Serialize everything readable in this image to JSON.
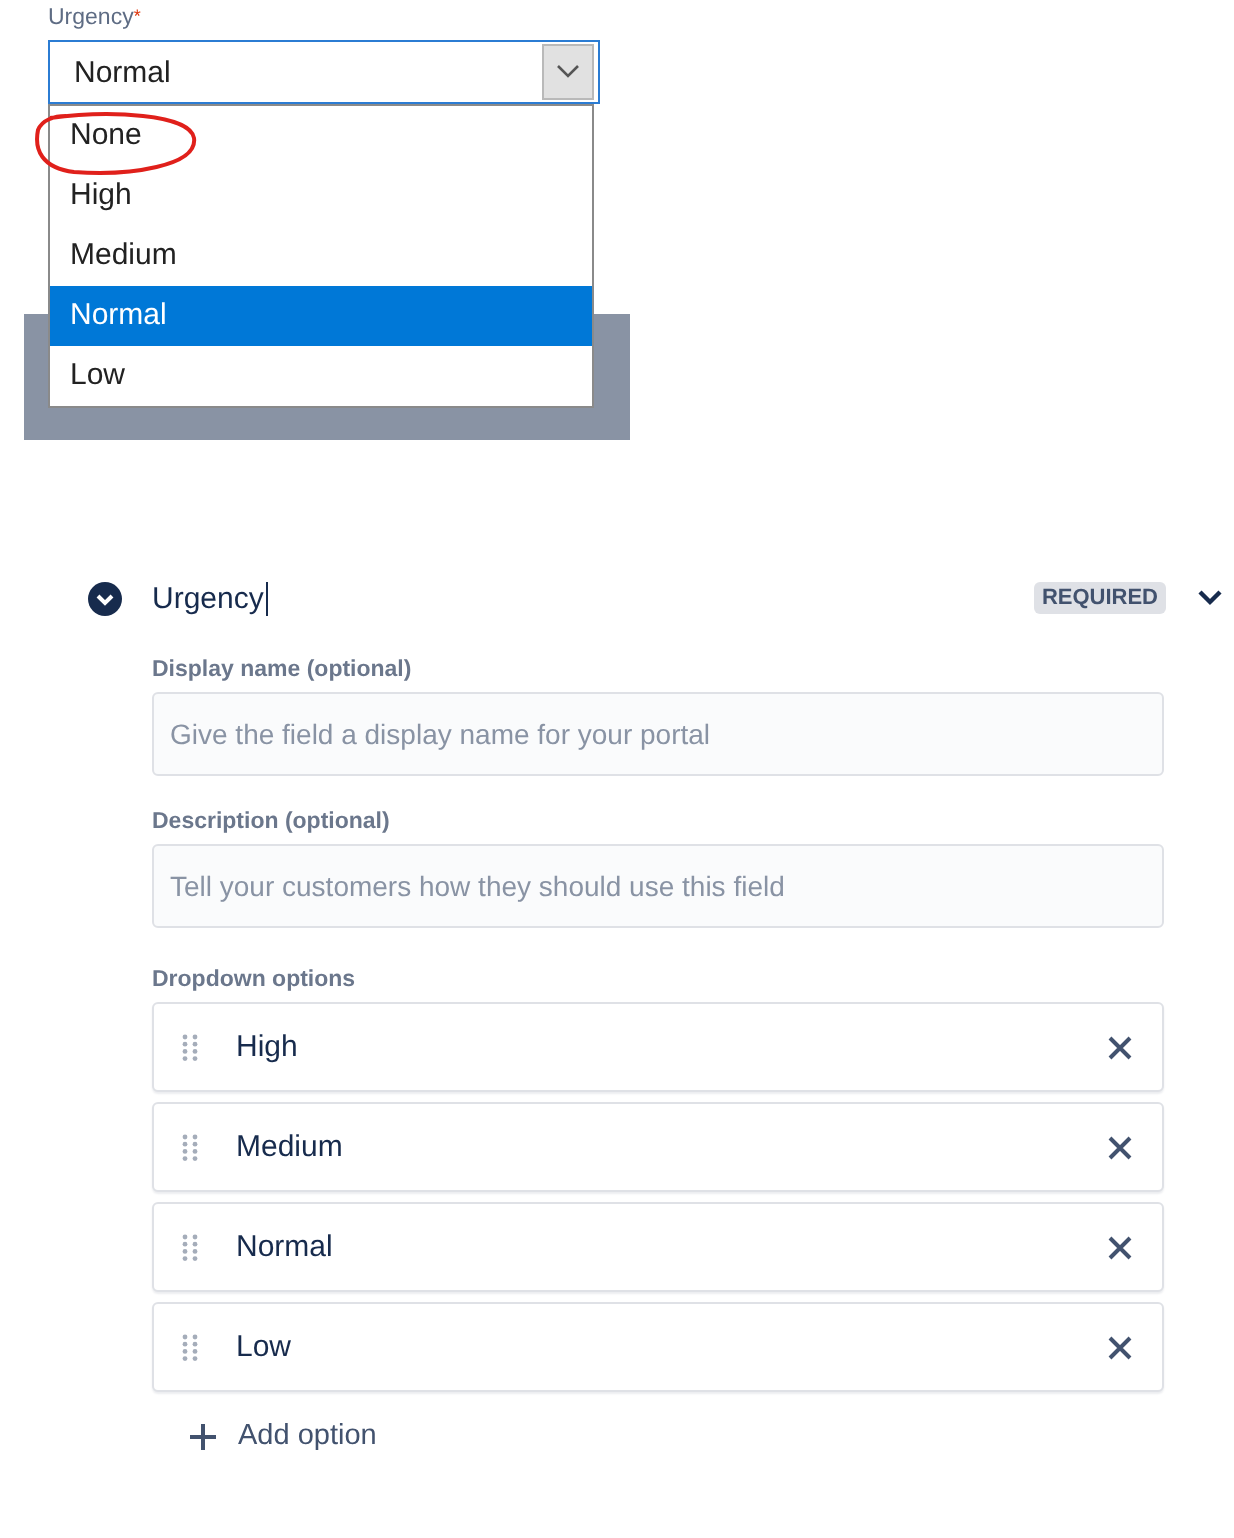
{
  "select": {
    "label": "Urgency",
    "required_mark": "*",
    "value": "Normal",
    "options": [
      {
        "label": "None",
        "selected": false,
        "circled": true
      },
      {
        "label": "High",
        "selected": false,
        "circled": false
      },
      {
        "label": "Medium",
        "selected": false,
        "circled": false
      },
      {
        "label": "Normal",
        "selected": true,
        "circled": false
      },
      {
        "label": "Low",
        "selected": false,
        "circled": false
      }
    ]
  },
  "field": {
    "name": "Urgency",
    "expanded": true,
    "editing": true,
    "badge": "REQUIRED",
    "inputs": [
      {
        "label": "Display name (optional)",
        "placeholder": "Give the field a display name for your portal"
      },
      {
        "label": "Description (optional)",
        "placeholder": "Tell your customers how they should use this field"
      }
    ],
    "options_label": "Dropdown options",
    "options": [
      "High",
      "Medium",
      "Normal",
      "Low"
    ],
    "add_option": "Add option"
  }
}
